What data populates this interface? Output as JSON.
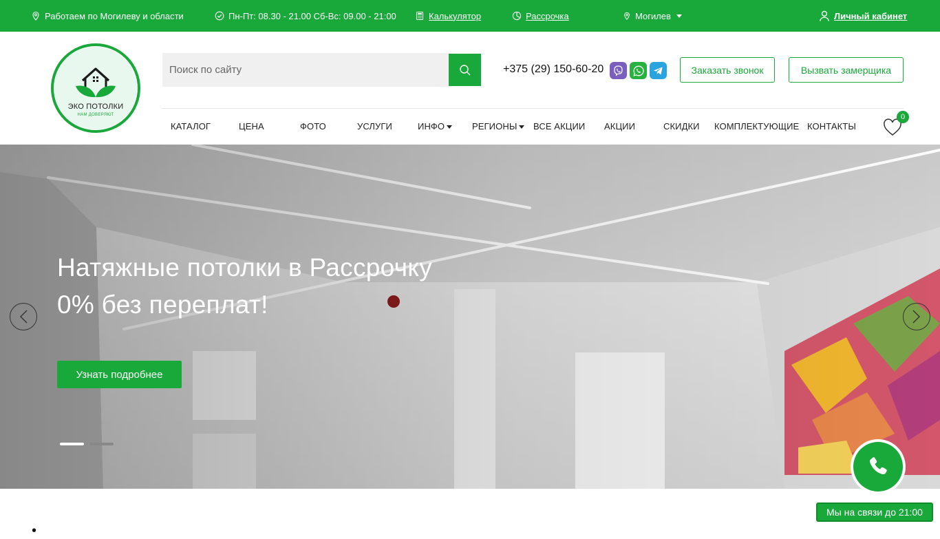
{
  "topbar": {
    "region": "Работаем по Могилеву и области",
    "hours": "Пн-Пт: 08.30 - 21.00 Сб-Вс: 09.00 - 21:00",
    "calculator": "Калькулятор",
    "installment": "Рассрочка",
    "city": "Могилев",
    "cabinet": "Личный кабинет"
  },
  "logo": {
    "word": "ЭКО ПОТОЛКИ",
    "tagline": "НАМ ДОВЕРЯЮТ"
  },
  "search": {
    "placeholder": "Поиск по сайту"
  },
  "contacts": {
    "phone": "+375 (29) 150-60-20",
    "messengers": [
      "viber-icon",
      "whatsapp-icon",
      "telegram-icon"
    ],
    "callback_button": "Заказать звонок",
    "measurer_button": "Вызвать замерщика"
  },
  "nav": {
    "items": [
      {
        "label": "Каталог",
        "dropdown": false
      },
      {
        "label": "Цена",
        "dropdown": false
      },
      {
        "label": "Фото",
        "dropdown": false
      },
      {
        "label": "Услуги",
        "dropdown": false
      },
      {
        "label": "Инфо",
        "dropdown": true
      },
      {
        "label": "Регионы",
        "dropdown": true
      },
      {
        "label": "Все акции",
        "dropdown": false
      },
      {
        "label": "Акции",
        "dropdown": false
      },
      {
        "label": "Скидки",
        "dropdown": false
      },
      {
        "label": "Комплектующие",
        "dropdown": false
      },
      {
        "label": "Контакты",
        "dropdown": false
      }
    ],
    "favorites_count": "0"
  },
  "hero": {
    "title_line1": "Натяжные потолки в Рассрочку",
    "title_line2": "0% без переплат!",
    "button": "Узнать подробнее",
    "slides_total": 2,
    "active_slide": 1
  },
  "widgets": {
    "online_status": "Мы на связи до 21:00"
  },
  "colors": {
    "brand_green": "#19a83a",
    "white": "#ffffff"
  }
}
